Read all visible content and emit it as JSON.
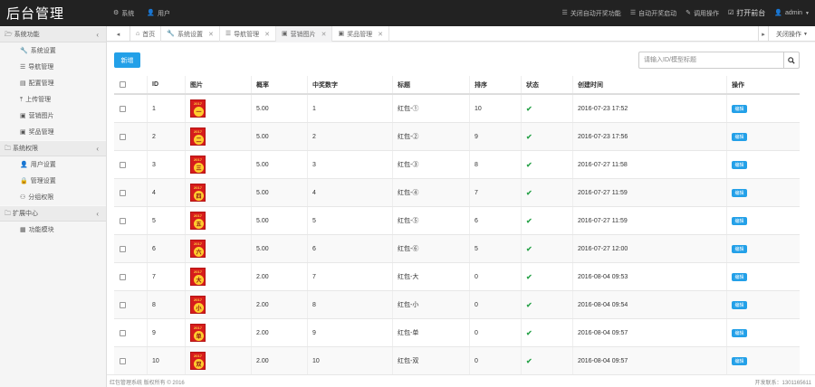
{
  "brand": "后台管理",
  "topnav": {
    "left": [
      {
        "icon": "gear",
        "label": "系统"
      },
      {
        "icon": "user",
        "label": "用户"
      }
    ],
    "right": [
      {
        "icon": "list",
        "label": "关闭自动开奖功能"
      },
      {
        "icon": "list",
        "label": "自动开奖启动"
      },
      {
        "icon": "pencil",
        "label": "调用操作"
      },
      {
        "icon": "check",
        "label": "打开前台"
      },
      {
        "icon": "user",
        "label": "admin"
      }
    ]
  },
  "sidebar": {
    "groups": [
      {
        "label": "系统功能",
        "items": [
          {
            "icon": "wrench",
            "label": "系统设置"
          },
          {
            "icon": "nav",
            "label": "导航管理"
          },
          {
            "icon": "config",
            "label": "配置管理"
          },
          {
            "icon": "upload",
            "label": "上传管理"
          },
          {
            "icon": "image",
            "label": "营销图片"
          },
          {
            "icon": "image",
            "label": "奖品管理"
          }
        ]
      },
      {
        "label": "系统权限",
        "items": [
          {
            "icon": "user",
            "label": "用户设置"
          },
          {
            "icon": "lock",
            "label": "管理设置"
          },
          {
            "icon": "group",
            "label": "分组权限"
          }
        ]
      },
      {
        "label": "扩展中心",
        "items": [
          {
            "icon": "grid",
            "label": "功能模块"
          }
        ]
      }
    ]
  },
  "tabs": {
    "items": [
      {
        "icon": "home",
        "label": "首页",
        "closable": false
      },
      {
        "icon": "wrench",
        "label": "系统设置",
        "closable": true
      },
      {
        "icon": "nav",
        "label": "导航管理",
        "closable": true
      },
      {
        "icon": "image",
        "label": "营销图片",
        "closable": true,
        "active": true
      },
      {
        "icon": "image",
        "label": "奖品管理",
        "closable": true
      }
    ],
    "close_ops": "关闭操作"
  },
  "toolbar": {
    "new_label": "新增",
    "search_placeholder": "请输入ID/模型标题"
  },
  "table": {
    "headers": [
      "",
      "ID",
      "图片",
      "概率",
      "中奖数字",
      "标题",
      "排序",
      "状态",
      "创建时间",
      "操作"
    ],
    "edit_label": "编辑",
    "rows": [
      {
        "id": "1",
        "img": "一",
        "prob": "5.00",
        "num": "1",
        "title": "红包-①",
        "sort": "10",
        "created": "2016-07-23 17:52"
      },
      {
        "id": "2",
        "img": "二",
        "prob": "5.00",
        "num": "2",
        "title": "红包-②",
        "sort": "9",
        "created": "2016-07-23 17:56"
      },
      {
        "id": "3",
        "img": "三",
        "prob": "5.00",
        "num": "3",
        "title": "红包-③",
        "sort": "8",
        "created": "2016-07-27 11:58"
      },
      {
        "id": "4",
        "img": "四",
        "prob": "5.00",
        "num": "4",
        "title": "红包-④",
        "sort": "7",
        "created": "2016-07-27 11:59"
      },
      {
        "id": "5",
        "img": "五",
        "prob": "5.00",
        "num": "5",
        "title": "红包-⑤",
        "sort": "6",
        "created": "2016-07-27 11:59"
      },
      {
        "id": "6",
        "img": "六",
        "prob": "5.00",
        "num": "6",
        "title": "红包-⑥",
        "sort": "5",
        "created": "2016-07-27 12:00"
      },
      {
        "id": "7",
        "img": "大",
        "prob": "2.00",
        "num": "7",
        "title": "红包-大",
        "sort": "0",
        "created": "2016-08-04 09:53"
      },
      {
        "id": "8",
        "img": "小",
        "prob": "2.00",
        "num": "8",
        "title": "红包-小",
        "sort": "0",
        "created": "2016-08-04 09:54"
      },
      {
        "id": "9",
        "img": "单",
        "prob": "2.00",
        "num": "9",
        "title": "红包-单",
        "sort": "0",
        "created": "2016-08-04 09:57"
      },
      {
        "id": "10",
        "img": "双",
        "prob": "2.00",
        "num": "10",
        "title": "红包-双",
        "sort": "0",
        "created": "2016-08-04 09:57"
      }
    ],
    "img_year": "2017"
  },
  "footer": {
    "left": "红包管理系统 版权所有 © 2016",
    "right": "开发联系：1301165611"
  }
}
